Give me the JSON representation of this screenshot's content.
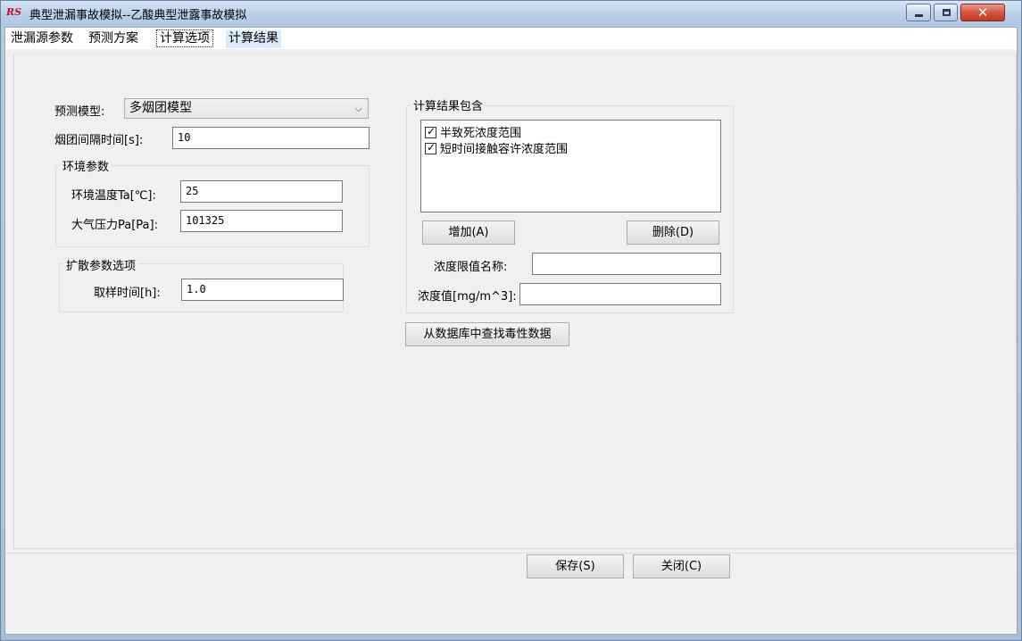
{
  "window": {
    "logo_text": "RS",
    "title": "典型泄漏事故模拟--乙酸典型泄露事故模拟"
  },
  "tabs": [
    {
      "label": "泄漏源参数"
    },
    {
      "label": "预测方案"
    },
    {
      "label": "计算选项"
    },
    {
      "label": "计算结果"
    }
  ],
  "form": {
    "model_label": "预测模型:",
    "model_value": "多烟团模型",
    "interval_label": "烟团间隔时间[s]:",
    "interval_value": "10",
    "env_group": "环境参数",
    "temp_label": "环境温度Ta[℃]:",
    "temp_value": "25",
    "pressure_label": "大气压力Pa[Pa]:",
    "pressure_value": "101325",
    "diffusion_group": "扩散参数选项",
    "sample_label": "取样时间[h]:",
    "sample_value": "1.0"
  },
  "results": {
    "group": "计算结果包含",
    "items": [
      {
        "label": "半致死浓度范围",
        "checked": true
      },
      {
        "label": "短时间接触容许浓度范围",
        "checked": true
      }
    ],
    "add_label": "增加(A)",
    "delete_label": "删除(D)",
    "limit_name_label": "浓度限值名称:",
    "limit_name_value": "",
    "conc_label": "浓度值[mg/m^3]:",
    "conc_value": "",
    "db_button": "从数据库中查找毒性数据"
  },
  "footer": {
    "save_label": "保存(S)",
    "close_label": "关闭(C)"
  }
}
